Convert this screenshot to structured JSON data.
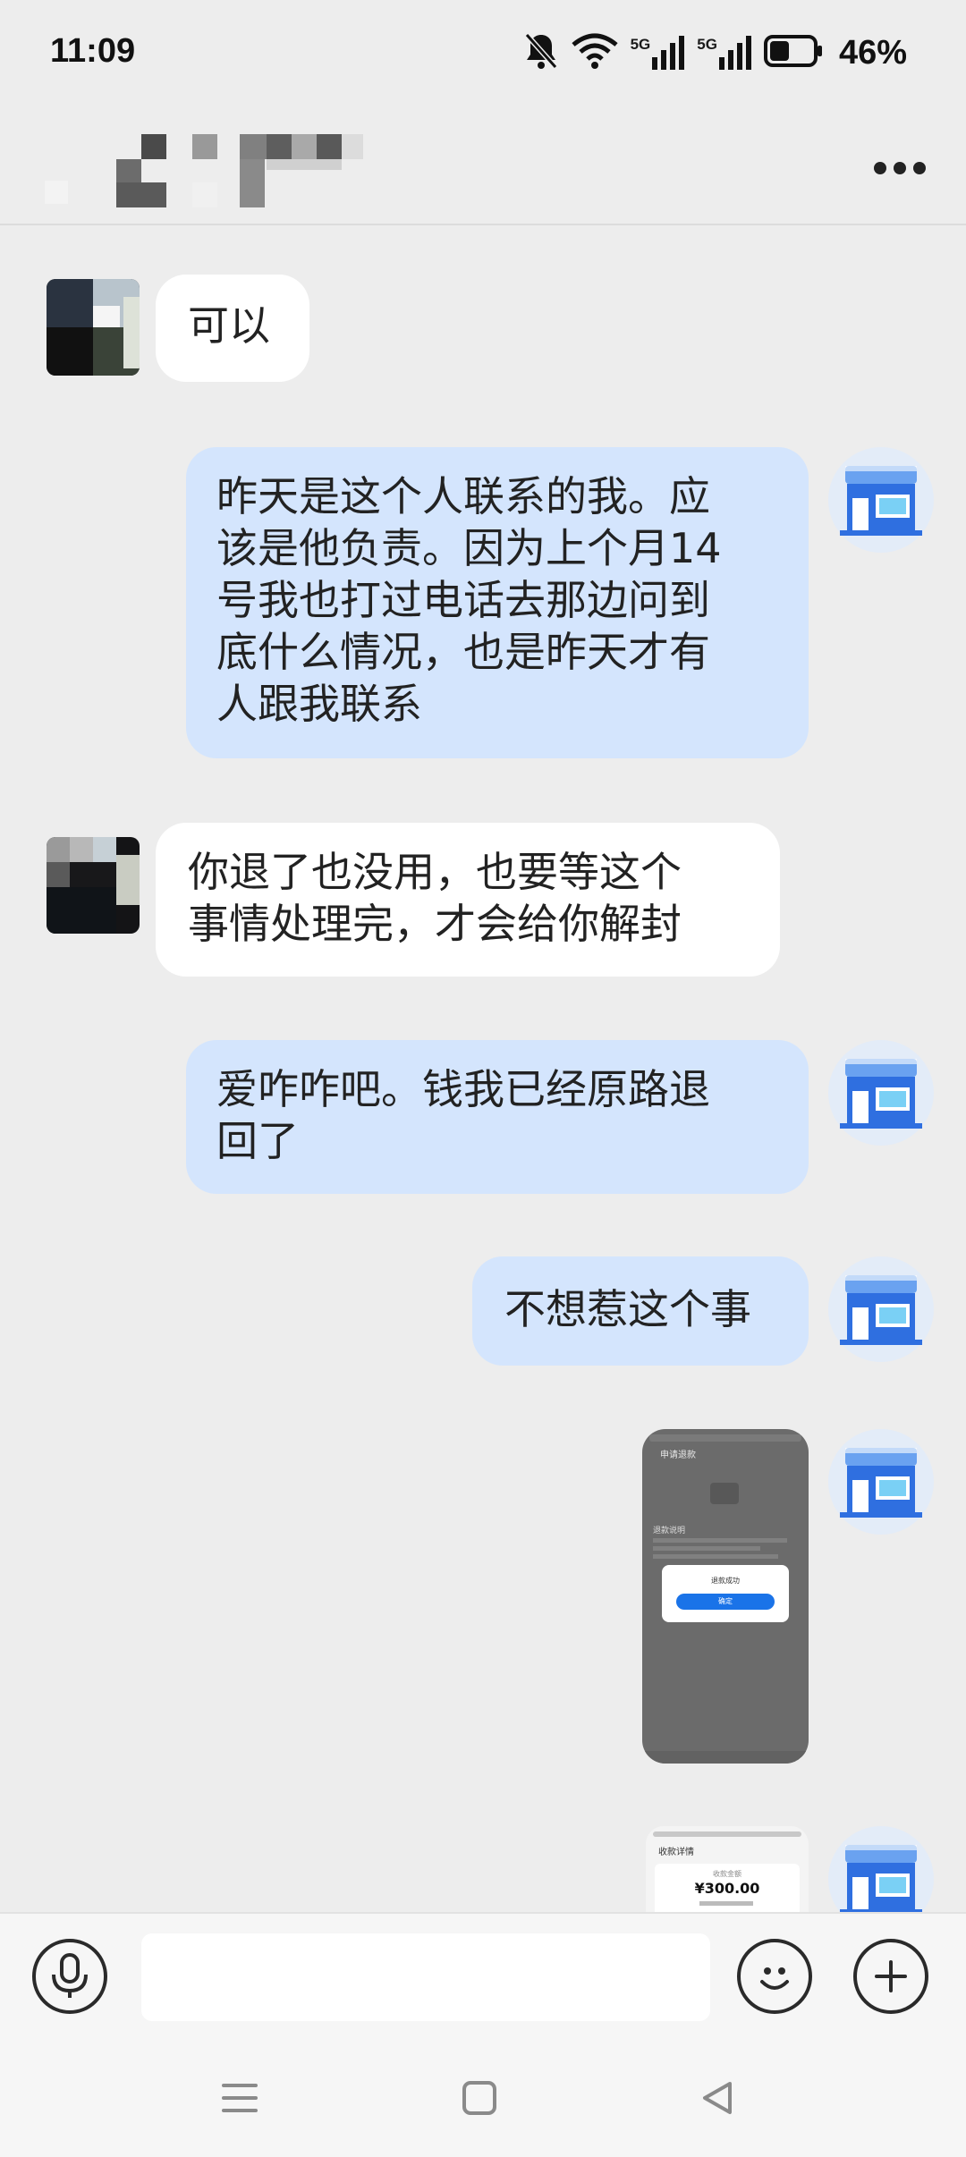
{
  "status_bar": {
    "time": "11:09",
    "network_1": "5G",
    "network_2": "5G",
    "battery_level": 0.46,
    "battery_text": "46%",
    "icons": [
      "mute-bell-icon",
      "wifi-icon",
      "signal-5g-icon",
      "signal-5g-icon",
      "battery-icon"
    ]
  },
  "header": {
    "title_obscured": true,
    "more_icon": "more-dots-icon"
  },
  "messages": [
    {
      "side": "in",
      "type": "text",
      "text": "可以"
    },
    {
      "side": "out",
      "type": "text",
      "lines": [
        "昨天是这个人联系的我。应",
        "该是他负责。因为上个月14",
        "号我也打过电话去那边问到",
        "底什么情况，也是昨天才有",
        "人跟我联系"
      ]
    },
    {
      "side": "in",
      "type": "text",
      "lines": [
        "你退了也没用，也要等这个",
        "事情处理完，才会给你解封"
      ]
    },
    {
      "side": "out",
      "type": "text",
      "lines": [
        "爱咋咋吧。钱我已经原路退",
        "回了"
      ]
    },
    {
      "side": "out",
      "type": "text",
      "text": "不想惹这个事"
    },
    {
      "side": "out",
      "type": "image",
      "screen_title": "申请退款",
      "section_title": "退款说明",
      "dialog_text": "退款成功",
      "dialog_button": "确定"
    },
    {
      "side": "out",
      "type": "image",
      "screen_title": "收款详情",
      "amount_label": "收款金额",
      "amount": "¥300.00"
    }
  ],
  "input_bar": {
    "voice_icon": "microphone-icon",
    "input_placeholder": "",
    "emoji_icon": "emoji-icon",
    "plus_icon": "plus-icon"
  },
  "nav_bar": {
    "icons": [
      "menu-icon",
      "home-square-icon",
      "back-triangle-icon"
    ]
  },
  "colors": {
    "background": "#ededed",
    "incoming_bubble": "#ffffff",
    "outgoing_bubble": "#d4e5fd",
    "store_avatar_blue": "#2f6fe0"
  }
}
